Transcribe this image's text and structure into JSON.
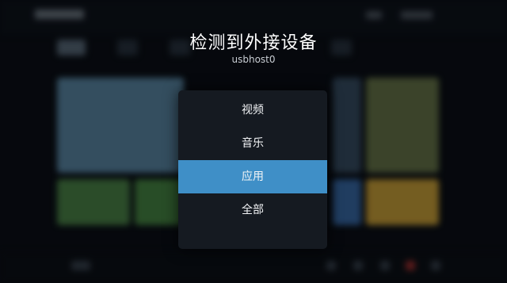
{
  "dialog": {
    "title": "检测到外接设备",
    "device_name": "usbhost0",
    "options": [
      {
        "label": "视频",
        "selected": false
      },
      {
        "label": "音乐",
        "selected": false
      },
      {
        "label": "应用",
        "selected": true
      },
      {
        "label": "全部",
        "selected": false
      }
    ],
    "highlight_color": "#3f8fc7"
  }
}
